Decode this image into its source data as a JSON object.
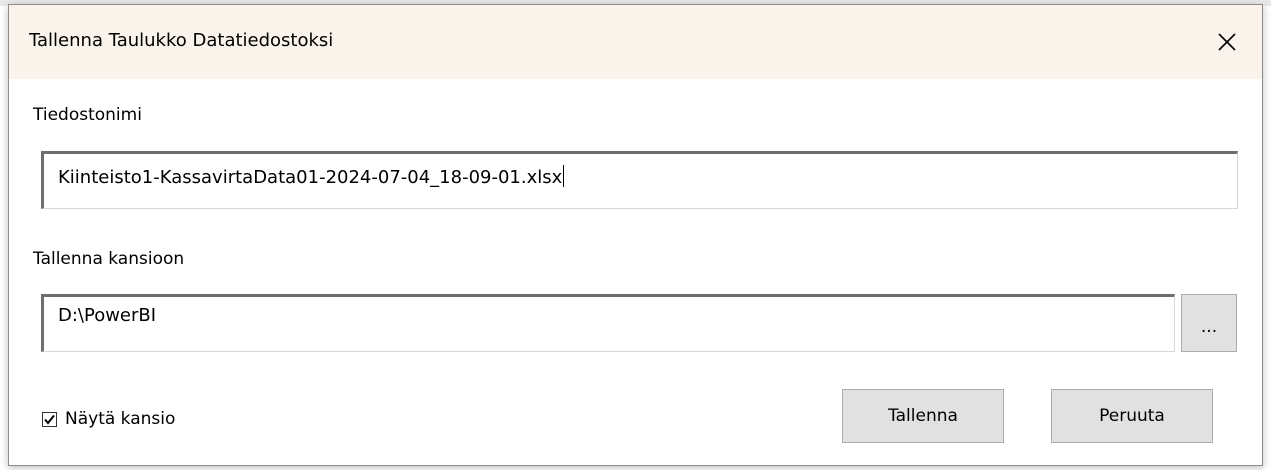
{
  "dialog": {
    "title": "Tallenna Taulukko Datatiedostoksi",
    "close_icon": "close-icon"
  },
  "filename": {
    "label": "Tiedostonimi",
    "value": "Kiinteisto1-KassavirtaData01-2024-07-04_18-09-01.xlsx"
  },
  "folder": {
    "label": "Tallenna kansioon",
    "value": "D:\\PowerBI",
    "browse_label": "..."
  },
  "show_folder": {
    "label": "Näytä kansio",
    "checked": true
  },
  "buttons": {
    "save_label": "Tallenna",
    "cancel_label": "Peruuta"
  }
}
